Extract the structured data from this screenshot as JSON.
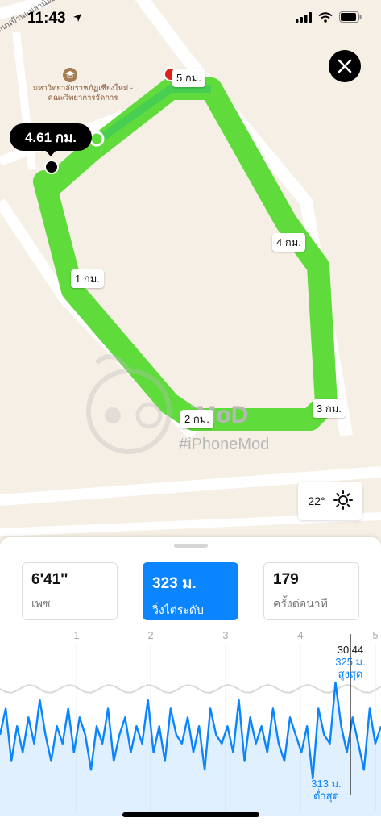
{
  "status_bar": {
    "time": "11:43"
  },
  "map": {
    "road_label": "ถนนบ้านแม่ลาน้อย",
    "place_name_line1": "มหาวิทยาลัยราชภัฏเชียงใหม่ -",
    "place_name_line2": "คณะวิทยาการจัดการ",
    "selected_distance": "4.61 กม.",
    "km_markers": [
      "1 กม.",
      "2 กม.",
      "3 กม.",
      "4 กม.",
      "5 กม."
    ],
    "route_color": "#5fdc3c",
    "watermark_line1": "iMoD",
    "watermark_line2": "#iPhoneMod"
  },
  "weather": {
    "temperature": "22°",
    "icon": "sun-icon"
  },
  "metrics": [
    {
      "value": "6'41''",
      "label": "เพซ",
      "selected": false
    },
    {
      "value": "323 ม.",
      "label": "วิ่งไต่ระดับ",
      "selected": true
    },
    {
      "value": "179",
      "label": "ครั้งต่อนาที",
      "selected": false
    }
  ],
  "chart_data": {
    "type": "line",
    "x_ticks": [
      "1",
      "2",
      "3",
      "4",
      "5"
    ],
    "marker_time": "30:44",
    "max_label_value": "325 ม.",
    "max_label_text": "สูงสุด",
    "min_label_value": "313 ม.",
    "min_label_text": "ต่ำสุด",
    "ylim": [
      313,
      325
    ],
    "series_color": "#0a84ff",
    "values": [
      319,
      322,
      316,
      320,
      317,
      321,
      318,
      323,
      319,
      316,
      320,
      318,
      322,
      317,
      321,
      319,
      315,
      320,
      318,
      322,
      316,
      319,
      321,
      317,
      320,
      318,
      323,
      317,
      320,
      316,
      322,
      319,
      318,
      321,
      317,
      320,
      315,
      322,
      319,
      318,
      320,
      317,
      323,
      316,
      321,
      318,
      320,
      317,
      322,
      318,
      316,
      321,
      319,
      317,
      320,
      314,
      322,
      319,
      318,
      325,
      320,
      317,
      321,
      318,
      315,
      322,
      318,
      320
    ]
  }
}
